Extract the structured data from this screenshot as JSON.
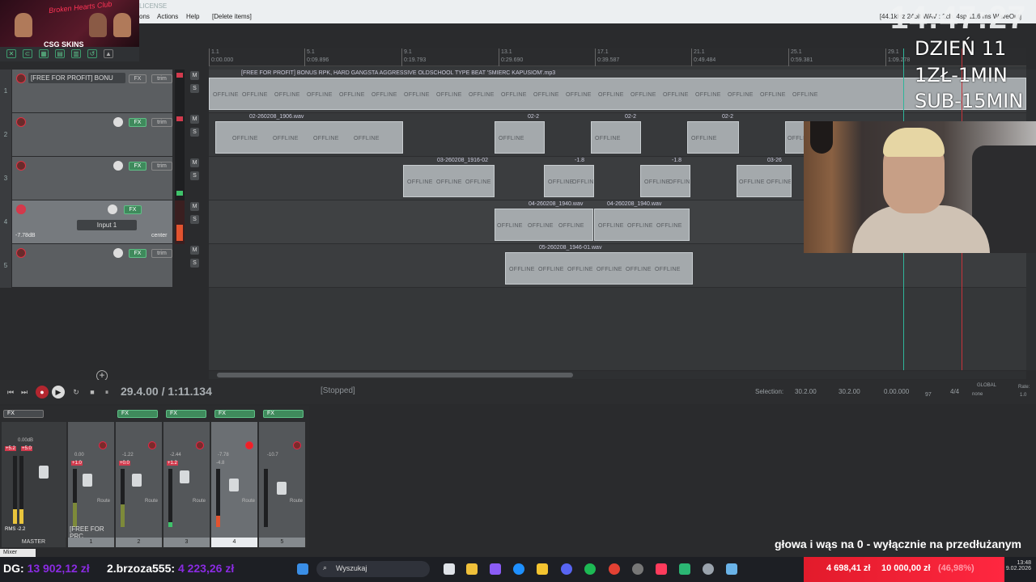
{
  "menubar": {
    "title": "LICENSE",
    "menus": [
      "ons",
      "Actions",
      "Help",
      "[Delete items]"
    ],
    "status": "[44.1kHz 24bit WAV : 2ch, 4sp 11.6 ms WaveOut]"
  },
  "stream": {
    "logo_text": "Broken Hearts Club",
    "sponsor": "CSG SKINS",
    "clock": "14:47:27",
    "day": "DZIEŃ 11",
    "rate": "1ZŁ-1MIN",
    "sub": "SUB-15MIN",
    "ticker": "głowa i wąs na 0 - wyłącznie na przedłużanym"
  },
  "tracks": [
    {
      "num": "1",
      "name": "[FREE FOR PROFIT] BONU",
      "fx_on": false
    },
    {
      "num": "2",
      "name": "",
      "fx_on": true
    },
    {
      "num": "3",
      "name": "",
      "fx_on": true
    },
    {
      "num": "4",
      "name": "",
      "fx_on": true,
      "input": "Input 1",
      "gain": "-7.78dB",
      "pan": "center"
    },
    {
      "num": "5",
      "name": "",
      "fx_on": true
    }
  ],
  "tcp_labels": {
    "fx": "FX",
    "trim": "trim",
    "m": "M",
    "s": "S"
  },
  "ruler": [
    {
      "bar": "1.1",
      "time": "0:00.000"
    },
    {
      "bar": "5.1",
      "time": "0:09.896"
    },
    {
      "bar": "9.1",
      "time": "0:19.793"
    },
    {
      "bar": "13.1",
      "time": "0:29.690"
    },
    {
      "bar": "17.1",
      "time": "0:39.587"
    },
    {
      "bar": "21.1",
      "time": "0:49.484"
    },
    {
      "bar": "25.1",
      "time": "0:59.381"
    },
    {
      "bar": "29.1",
      "time": "1:09.278"
    }
  ],
  "items": {
    "t1": "[FREE FOR PROFIT] BONUS RPK, HARD GANGSTA AGGRESSIVE OLDSCHOOL TYPE BEAT 'SMIERC KAPUSIOM'.mp3",
    "t2a": "02-260208_1906.wav",
    "t2b": "02-2",
    "t3a": "03-260208_1916-02",
    "t3b": "-1.8",
    "t3c": "03-26",
    "t4": "04-260208_1940.wav",
    "t5": "05-260208_1946-01.wav",
    "offline": "OFFLINE"
  },
  "transport": {
    "time": "29.4.00 / 1:11.134",
    "status": "[Stopped]",
    "selection_label": "Selection:",
    "sel_start": "30.2.00",
    "sel_end": "30.2.00",
    "sel_len": "0.00.000",
    "bpm": "97",
    "signature": "4/4",
    "global": "GLOBAL",
    "none": "none",
    "rate_label": "Rate:",
    "rate": "1.0"
  },
  "mixer": {
    "master_label": "MASTER",
    "master_vol": "0.00dB",
    "master_rms": "RMS -2.2",
    "peaks": [
      "+5.2",
      "+5.0"
    ],
    "fx_label": "FX",
    "route": "Route",
    "strips": [
      {
        "num": "1",
        "name": "[FREE FOR PRC",
        "peak": "+1.0",
        "vol": "0.00",
        "selected": false
      },
      {
        "num": "2",
        "name": "",
        "peak": "+0.0",
        "vol": "-1.22",
        "selected": false
      },
      {
        "num": "3",
        "name": "",
        "peak": "+1.2",
        "vol": "-2.44",
        "selected": false
      },
      {
        "num": "4",
        "name": "",
        "peak": "-4.8",
        "vol": "-7.78",
        "selected": true
      },
      {
        "num": "5",
        "name": "",
        "peak": "",
        "vol": "-10.7",
        "selected": false
      }
    ],
    "tab": "Mixer"
  },
  "taskbar": {
    "donor1_name": "DG:",
    "donor1_amt": "13 902,12 zł",
    "donor2_name": "2.brzoza555:",
    "donor2_amt": "4 223,26 zł",
    "search": "Wyszukaj",
    "goal_current": "4 698,41 zł",
    "goal_target": "10 000,00 zł",
    "goal_pct": "(46,98%)",
    "time": "13:48",
    "date": "9.02.2026"
  },
  "colors": {
    "accent_green": "#3f8a5c",
    "rec_red": "#d23a4d",
    "goal_red": "#e21b2b",
    "donor_purple": "#8a2be2"
  }
}
